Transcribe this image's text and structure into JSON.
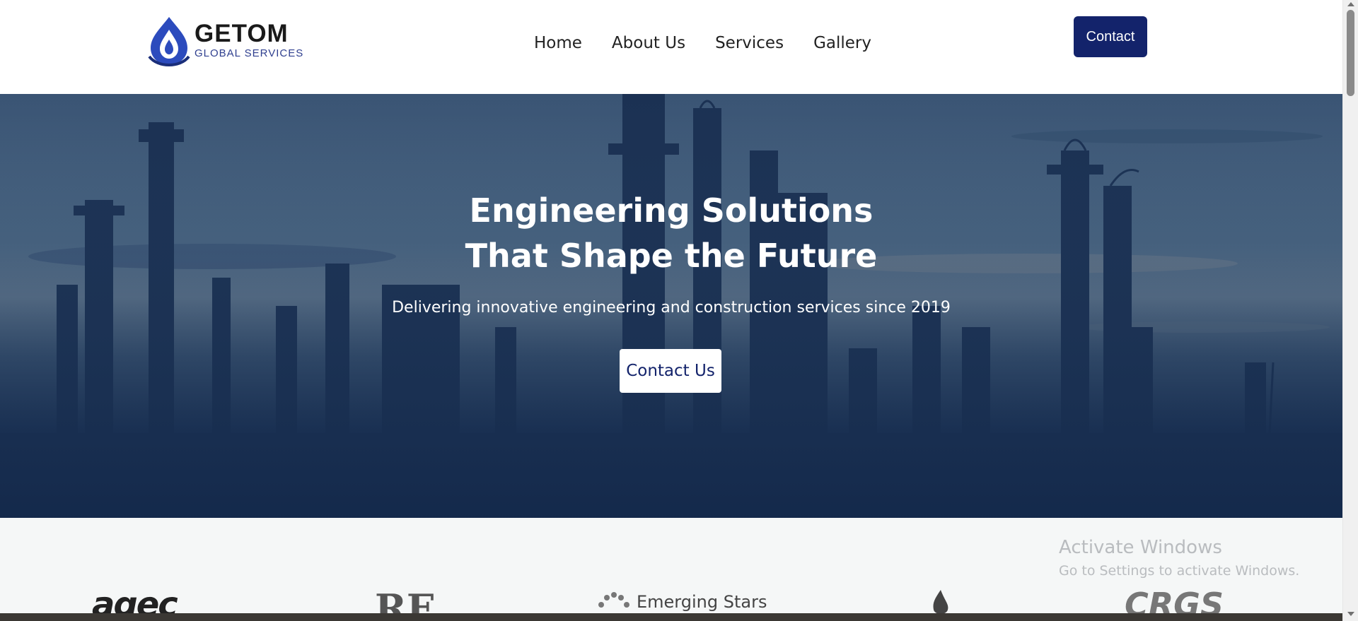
{
  "brand": {
    "name": "GETOM",
    "tagline": "GLOBAL SERVICES",
    "primary_color": "#13236b"
  },
  "nav": {
    "items": [
      "Home",
      "About Us",
      "Services",
      "Gallery"
    ],
    "contact_label": "Contact"
  },
  "hero": {
    "title_line1": "Engineering Solutions",
    "title_line2": "That Shape the Future",
    "subtitle": "Delivering innovative engineering and construction services since 2019",
    "cta_label": "Contact Us"
  },
  "partners": {
    "logo1": "agec",
    "logo2": "RE",
    "logo3": "Emerging Stars",
    "logo5": "CRGS"
  },
  "watermark": {
    "title": "Activate Windows",
    "subtitle": "Go to Settings to activate Windows."
  },
  "icons": {
    "logo_mark": "water-drop-icon",
    "flame": "flame-icon"
  }
}
